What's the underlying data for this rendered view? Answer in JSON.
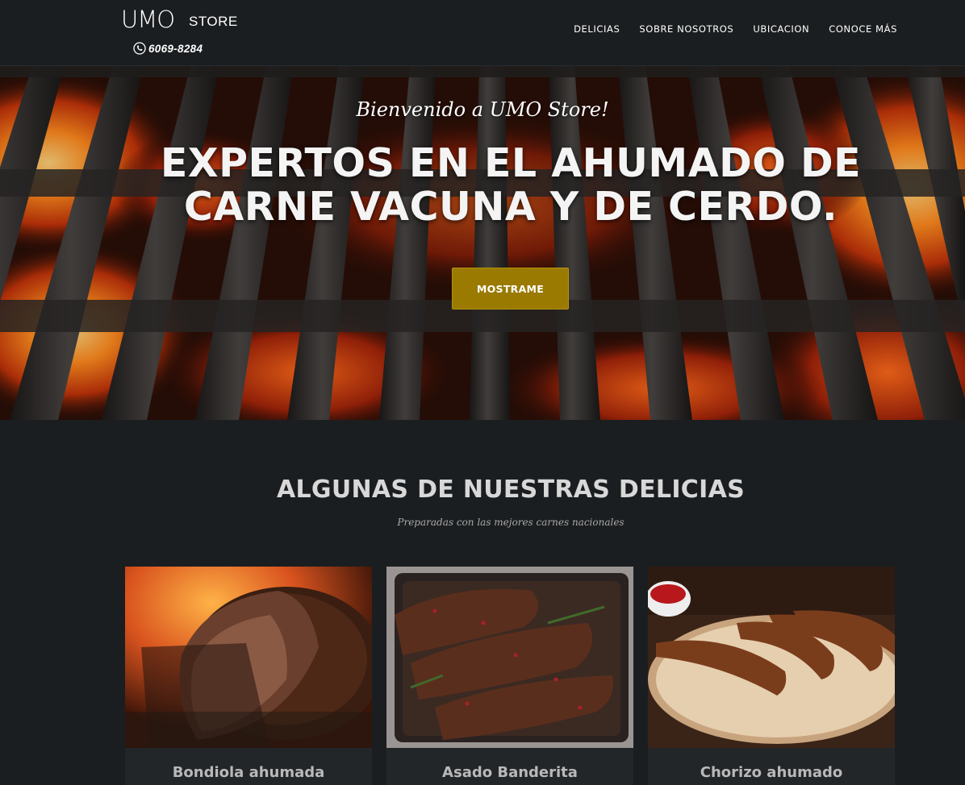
{
  "brand": {
    "logo_main": "UMO",
    "logo_sub": "STORE",
    "phone": "6069-8284"
  },
  "nav": {
    "items": [
      {
        "label": "DELICIAS"
      },
      {
        "label": "SOBRE NOSOTROS"
      },
      {
        "label": "UBICACION"
      },
      {
        "label": "CONOCE MÁS"
      }
    ]
  },
  "hero": {
    "subtitle": "Bienvenido a UMO Store!",
    "title_line1": "EXPERTOS EN EL AHUMADO DE",
    "title_line2": "CARNE VACUNA Y DE CERDO.",
    "button_label": "MOSTRAME"
  },
  "section": {
    "title": "ALGUNAS DE NUESTRAS DELICIAS",
    "subtitle": "Preparadas con las mejores carnes nacionales"
  },
  "products": [
    {
      "name": "Bondiola ahumada",
      "image": "smoked-pork-roast"
    },
    {
      "name": "Asado Banderita",
      "image": "grilled-ribs-tray"
    },
    {
      "name": "Chorizo ahumado",
      "image": "smoked-sausages-board"
    }
  ],
  "colors": {
    "background": "#1b1e20",
    "accent_button": "#9a7a00",
    "card_background": "#232629"
  }
}
